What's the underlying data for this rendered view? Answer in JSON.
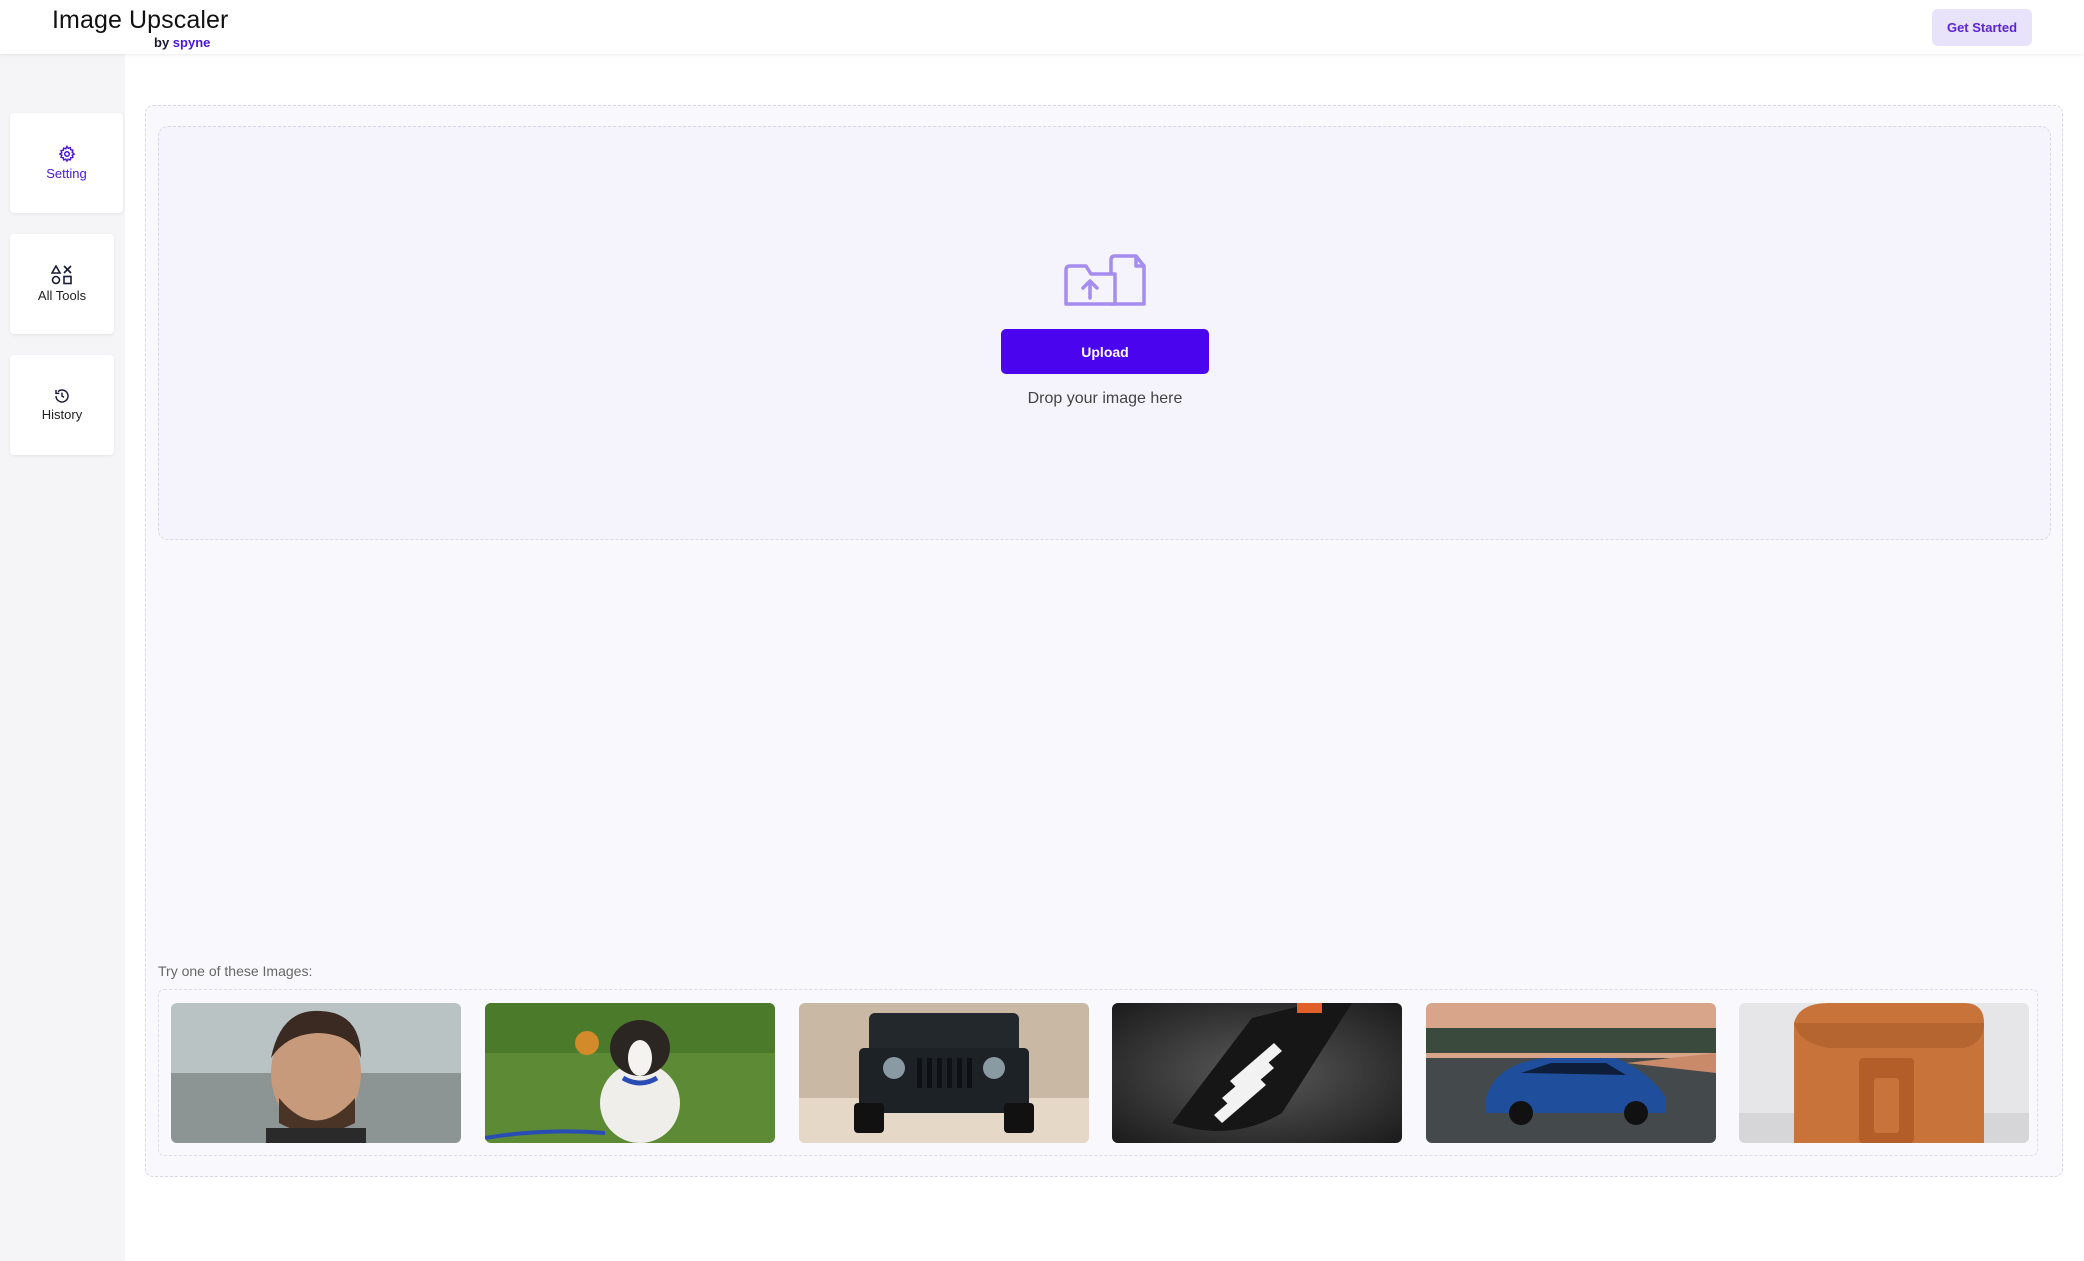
{
  "header": {
    "title": "Image Upscaler",
    "by_prefix": "by",
    "by_brand": "spyne",
    "get_started_label": "Get Started"
  },
  "sidebar": {
    "items": [
      {
        "label": "Setting",
        "icon": "gear-icon",
        "active": true
      },
      {
        "label": "All Tools",
        "icon": "shapes-icon",
        "active": false
      },
      {
        "label": "History",
        "icon": "history-icon",
        "active": false
      }
    ]
  },
  "upload": {
    "button_label": "Upload",
    "drop_text": "Drop your image here"
  },
  "samples": {
    "label": "Try one of these Images:",
    "images": [
      {
        "subject": "man portrait"
      },
      {
        "subject": "puppy on grass"
      },
      {
        "subject": "black jeep"
      },
      {
        "subject": "black sneaker"
      },
      {
        "subject": "blue sports car"
      },
      {
        "subject": "tan leather bag"
      }
    ]
  },
  "colors": {
    "accent": "#4a04ee",
    "accent_light": "#e9e2fb",
    "active_text": "#4a16d8"
  }
}
